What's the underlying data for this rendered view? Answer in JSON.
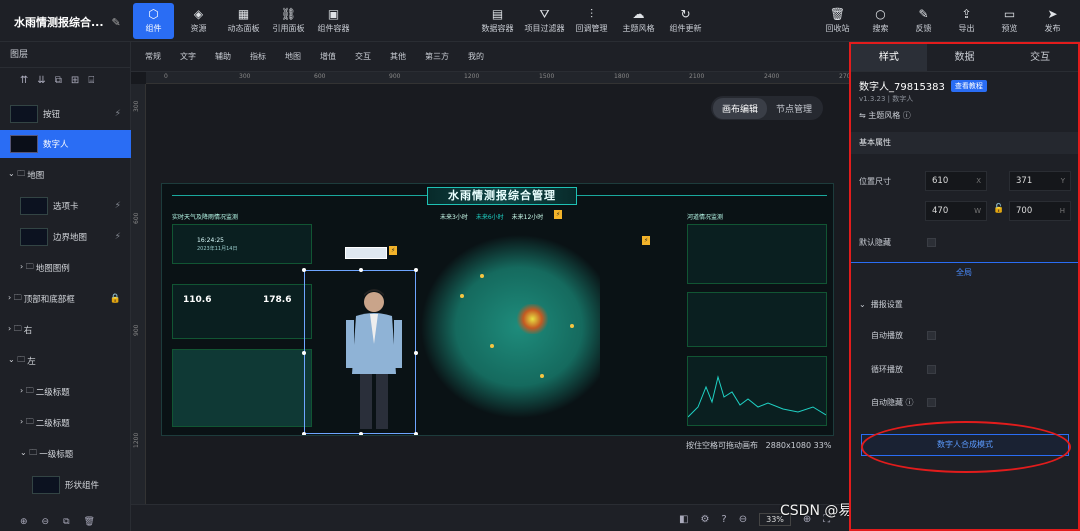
{
  "app": {
    "title": "水雨情测报综合..."
  },
  "toolbar_left": [
    {
      "icon": "component-icon",
      "glyph": "⬡",
      "label": "组件",
      "active": true
    },
    {
      "icon": "resource-icon",
      "glyph": "◈",
      "label": "资源"
    },
    {
      "icon": "dynamic-panel-icon",
      "glyph": "▦",
      "label": "动态面板"
    },
    {
      "icon": "reference-panel-icon",
      "glyph": "⛓",
      "label": "引用面板"
    },
    {
      "icon": "container-icon",
      "glyph": "▣",
      "label": "组件容器"
    }
  ],
  "toolbar_mid": [
    {
      "icon": "data-container-icon",
      "glyph": "▤",
      "label": "数据容器"
    },
    {
      "icon": "filter-icon",
      "glyph": "⛛",
      "label": "项目过滤器"
    },
    {
      "icon": "callback-icon",
      "glyph": "⫶",
      "label": "回调管理"
    },
    {
      "icon": "theme-icon",
      "glyph": "☁",
      "label": "主题风格"
    },
    {
      "icon": "update-icon",
      "glyph": "↻",
      "label": "组件更新"
    }
  ],
  "toolbar_right": [
    {
      "icon": "recycle-icon",
      "glyph": "🗑",
      "label": "回收站"
    },
    {
      "icon": "search-icon",
      "glyph": "○",
      "label": "搜索"
    },
    {
      "icon": "feedback-icon",
      "glyph": "✎",
      "label": "反馈"
    },
    {
      "icon": "export-icon",
      "glyph": "⇪",
      "label": "导出"
    },
    {
      "icon": "preview-icon",
      "glyph": "▭",
      "label": "预览"
    },
    {
      "icon": "publish-icon",
      "glyph": "➤",
      "label": "发布"
    }
  ],
  "layers": {
    "header": "图层",
    "tools": [
      "⇈",
      "⇊",
      "⧉",
      "⊞",
      "⌸"
    ],
    "items": [
      {
        "label": "按钮",
        "type": "thumb",
        "bolt": true
      },
      {
        "label": "数字人",
        "type": "thumb",
        "selected": true
      },
      {
        "label": "地图",
        "type": "folder",
        "expanded": true
      },
      {
        "label": "选项卡",
        "type": "thumb",
        "bolt": true
      },
      {
        "label": "边界地图",
        "type": "thumb",
        "bolt": true
      },
      {
        "label": "地图图例",
        "type": "folder"
      },
      {
        "label": "顶部和底部框",
        "type": "folder",
        "lock": true
      },
      {
        "label": "右",
        "type": "folder"
      },
      {
        "label": "左",
        "type": "folder",
        "expanded": true
      },
      {
        "label": "二级标题",
        "type": "folder"
      },
      {
        "label": "二级标题",
        "type": "folder"
      },
      {
        "label": "一级标题",
        "type": "folder",
        "expanded": true
      },
      {
        "label": "形状组件",
        "type": "thumb"
      }
    ],
    "bottom_icons": [
      "⊕",
      "⊖",
      "⧉",
      "🗑"
    ]
  },
  "component_tabs": [
    "常规",
    "文字",
    "辅助",
    "指标",
    "地图",
    "增值",
    "交互",
    "其他",
    "第三方",
    "我的"
  ],
  "ruler": {
    "h": [
      "0",
      "300",
      "600",
      "900",
      "1200",
      "1500",
      "1800",
      "2100",
      "2400",
      "2700"
    ],
    "v": [
      "300",
      "600",
      "900",
      "1200"
    ]
  },
  "canvas": {
    "mode_tabs": [
      "画布编辑",
      "节点管理"
    ],
    "info": "按住空格可拖动画布",
    "size": "2880x1080",
    "zoom": "33%"
  },
  "screen": {
    "title": "水雨情测报综合管理",
    "tabs": [
      "未来3小时",
      "未来6小时",
      "未来12小时"
    ],
    "left_title": "实时天气及降雨情况监测",
    "right_title": "河道情况监测",
    "stats": [
      "110.6",
      "178.6"
    ],
    "time": "16:24:25",
    "date": "2023年11月14日"
  },
  "statusbar": {
    "zoom": "33%"
  },
  "watermark": "CSDN @易知微EasyV数据可视化",
  "props": {
    "tabs": [
      "样式",
      "数据",
      "交互"
    ],
    "name": "数字人_79815383",
    "tutorial": "查看教程",
    "version": "v1.3.23 | 数字人",
    "theme": "主题风格",
    "basic_section": "基本属性",
    "pos_label": "位置尺寸",
    "x": "610",
    "x_unit": "X",
    "y": "371",
    "y_unit": "Y",
    "w": "470",
    "w_unit": "W",
    "h": "700",
    "h_unit": "H",
    "hide_label": "默认隐藏",
    "global": "全局",
    "broadcast_section": "播报设置",
    "autoplay": "自动播放",
    "loop": "循环播放",
    "autohide": "自动隐藏",
    "synth_btn": "数字人合成模式"
  }
}
